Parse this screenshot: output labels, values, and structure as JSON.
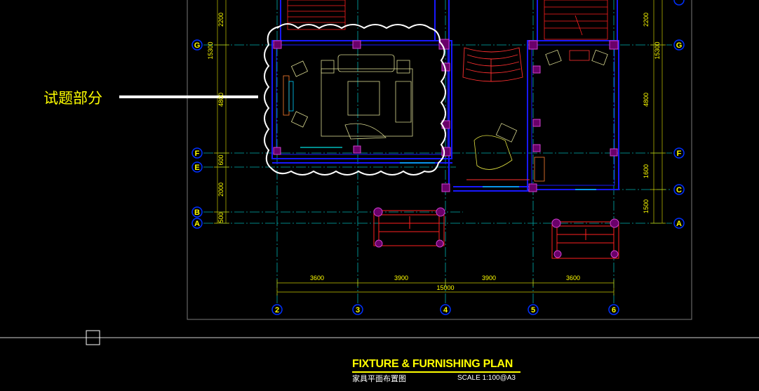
{
  "annotation": {
    "label": "试题部分"
  },
  "title_block": {
    "title_en": "FIXTURE & FURNISHING PLAN",
    "title_zh": "家具平面布置图",
    "scale": "SCALE  1:100@A3"
  },
  "grid_axes": {
    "vertical": [
      "2",
      "3",
      "4",
      "5",
      "6"
    ],
    "horizontal_left": [
      "G",
      "F",
      "E",
      "B",
      "A"
    ],
    "horizontal_right": [
      "G",
      "F",
      "C",
      "A"
    ]
  },
  "dimensions": {
    "bottom": [
      "3600",
      "3900",
      "3900",
      "3600"
    ],
    "total": "15000",
    "left": [
      "2200",
      "15300",
      "4800",
      "600",
      "2000",
      "500"
    ],
    "right": [
      "2200",
      "15300",
      "4800",
      "1600",
      "1500"
    ]
  },
  "colors": {
    "background": "#000000",
    "wall": "#0000ff",
    "column": "#c000c0",
    "grid": "#00c0c0",
    "dimension": "#ffff00",
    "cloud": "#ffffff",
    "stair": "#ff2020"
  }
}
